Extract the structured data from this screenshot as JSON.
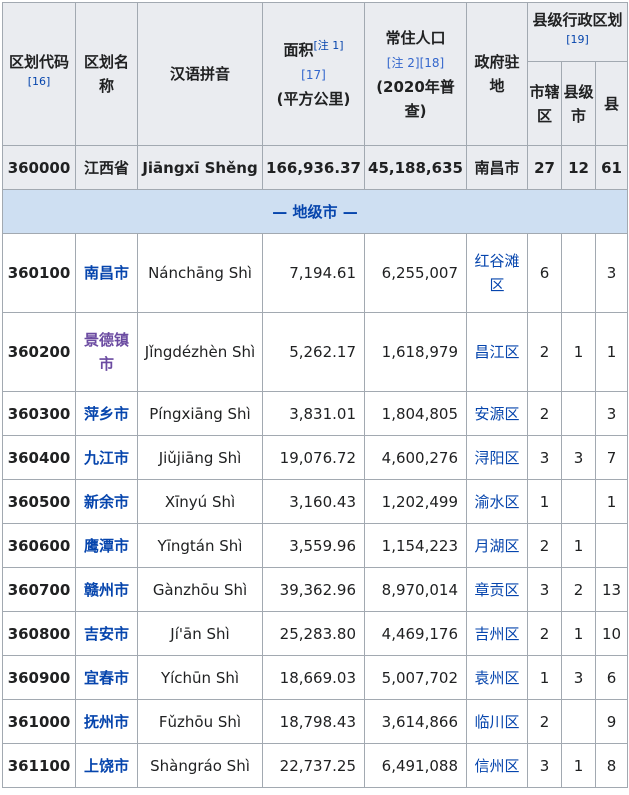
{
  "headers": {
    "code_label": "区划代码",
    "code_ref": "[16]",
    "name_label": "区划名称",
    "pinyin_label": "汉语拼音",
    "area_label": "面积",
    "area_note": "[注 1]",
    "area_ref": "[17]",
    "area_unit": "(平方公里)",
    "pop_label": "常住人口",
    "pop_ref": "[注 2][18]",
    "pop_unit": "(2020年普查)",
    "seat_label": "政府驻地",
    "county_group_label": "县级行政区划",
    "county_group_ref": "[19]",
    "districts_label": "市辖区",
    "county_cities_label": "县级市",
    "counties_label": "县"
  },
  "province": {
    "code": "360000",
    "name": "江西省",
    "pinyin": "Jiāngxī Shěng",
    "area": "166,936.37",
    "population": "45,188,635",
    "seat": "南昌市",
    "districts": "27",
    "county_cities": "12",
    "counties": "61"
  },
  "band_label": "— 地级市 —",
  "rows": [
    {
      "code": "360100",
      "name": "南昌市",
      "pinyin": "Nánchāng Shì",
      "area": "7,194.61",
      "population": "6,255,007",
      "seat": "红谷滩区",
      "districts": "6",
      "county_cities": "",
      "counties": "3"
    },
    {
      "code": "360200",
      "name": "景德镇市",
      "pinyin": "Jǐngdézhèn Shì",
      "area": "5,262.17",
      "population": "1,618,979",
      "seat": "昌江区",
      "districts": "2",
      "county_cities": "1",
      "counties": "1"
    },
    {
      "code": "360300",
      "name": "萍乡市",
      "pinyin": "Píngxiāng Shì",
      "area": "3,831.01",
      "population": "1,804,805",
      "seat": "安源区",
      "districts": "2",
      "county_cities": "",
      "counties": "3"
    },
    {
      "code": "360400",
      "name": "九江市",
      "pinyin": "Jiǔjiāng Shì",
      "area": "19,076.72",
      "population": "4,600,276",
      "seat": "浔阳区",
      "districts": "3",
      "county_cities": "3",
      "counties": "7"
    },
    {
      "code": "360500",
      "name": "新余市",
      "pinyin": "Xīnyú Shì",
      "area": "3,160.43",
      "population": "1,202,499",
      "seat": "渝水区",
      "districts": "1",
      "county_cities": "",
      "counties": "1"
    },
    {
      "code": "360600",
      "name": "鹰潭市",
      "pinyin": "Yīngtán Shì",
      "area": "3,559.96",
      "population": "1,154,223",
      "seat": "月湖区",
      "districts": "2",
      "county_cities": "1",
      "counties": ""
    },
    {
      "code": "360700",
      "name": "赣州市",
      "pinyin": "Gànzhōu Shì",
      "area": "39,362.96",
      "population": "8,970,014",
      "seat": "章贡区",
      "districts": "3",
      "county_cities": "2",
      "counties": "13"
    },
    {
      "code": "360800",
      "name": "吉安市",
      "pinyin": "Jí'ān Shì",
      "area": "25,283.80",
      "population": "4,469,176",
      "seat": "吉州区",
      "districts": "2",
      "county_cities": "1",
      "counties": "10"
    },
    {
      "code": "360900",
      "name": "宜春市",
      "pinyin": "Yíchūn Shì",
      "area": "18,669.03",
      "population": "5,007,702",
      "seat": "袁州区",
      "districts": "1",
      "county_cities": "3",
      "counties": "6"
    },
    {
      "code": "361000",
      "name": "抚州市",
      "pinyin": "Fǔzhōu Shì",
      "area": "18,798.43",
      "population": "3,614,866",
      "seat": "临川区",
      "districts": "2",
      "county_cities": "",
      "counties": "9"
    },
    {
      "code": "361100",
      "name": "上饶市",
      "pinyin": "Shàngráo Shì",
      "area": "22,737.25",
      "population": "6,491,088",
      "seat": "信州区",
      "districts": "3",
      "county_cities": "1",
      "counties": "8"
    }
  ],
  "colors": {
    "link": "#0645ad",
    "visited_link": "#6b4ba1",
    "header_bg": "#eaecf0",
    "band_bg": "#cedff2",
    "border": "#a2a9b1"
  }
}
